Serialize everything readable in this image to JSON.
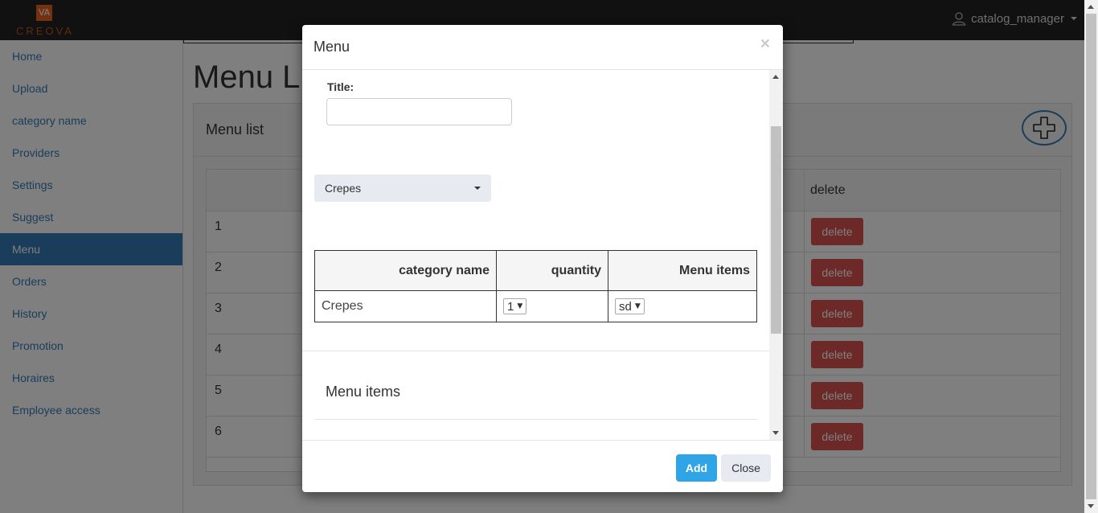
{
  "navbar": {
    "logo_mark": "VA",
    "logo_text": "CREOVA",
    "user": "catalog_manager"
  },
  "sidebar": {
    "items": [
      {
        "label": "Home"
      },
      {
        "label": "Upload"
      },
      {
        "label": "category name"
      },
      {
        "label": "Providers"
      },
      {
        "label": "Settings"
      },
      {
        "label": "Suggest"
      },
      {
        "label": "Menu",
        "active": true
      },
      {
        "label": "Orders"
      },
      {
        "label": "History"
      },
      {
        "label": "Promotion"
      },
      {
        "label": "Horaires"
      },
      {
        "label": "Employee access"
      }
    ]
  },
  "main": {
    "page_title": "Menu L",
    "panel_title": "Menu list",
    "table_header_delete": "delete",
    "rows": [
      {
        "index": "1",
        "delete_label": "delete"
      },
      {
        "index": "2",
        "delete_label": "delete"
      },
      {
        "index": "3",
        "delete_label": "delete"
      },
      {
        "index": "4",
        "delete_label": "delete"
      },
      {
        "index": "5",
        "delete_label": "delete"
      },
      {
        "index": "6",
        "delete_label": "delete"
      }
    ]
  },
  "modal": {
    "title": "Menu",
    "close_x": "×",
    "title_label": "Title:",
    "title_value": "",
    "category_dropdown": "Crepes",
    "table": {
      "headers": [
        "category name",
        "quantity",
        "Menu items"
      ],
      "rows": [
        {
          "category": "Crepes",
          "quantity": "1",
          "menu_item": "sd"
        }
      ]
    },
    "section_title": "Menu items",
    "add_button": "Add",
    "close_button": "Close"
  },
  "colors": {
    "navbar": "#222222",
    "accent": "#337ab7",
    "delete": "#d9534f",
    "add_button": "#2fa4e7",
    "logo": "#e8621f"
  }
}
